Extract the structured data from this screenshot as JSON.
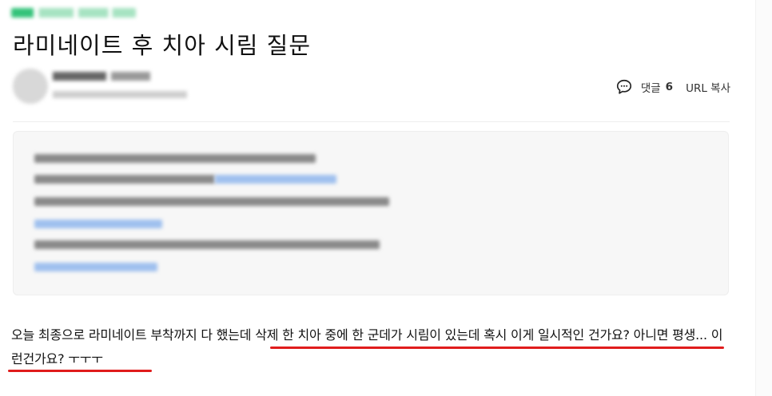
{
  "post": {
    "title": "라미네이트 후 치아 시림 질문",
    "body_text": "오늘 최종으로 라미네이트 부착까지 다 했는데 삭제 한 치아 중에 한 군데가 시림이 있는데 혹시 이게 일시적인 건가요? 아니면 평생... 이런건가요? ㅜㅜㅜ"
  },
  "meta": {
    "comment_label": "댓글",
    "comment_count": "6",
    "url_copy_label": "URL 복사",
    "comment_icon": "speech-bubble-icon"
  },
  "colors": {
    "highlight_underline": "#e01c1c",
    "quote_background": "#f7f7f7",
    "link_blur": "#9fc0ee"
  }
}
